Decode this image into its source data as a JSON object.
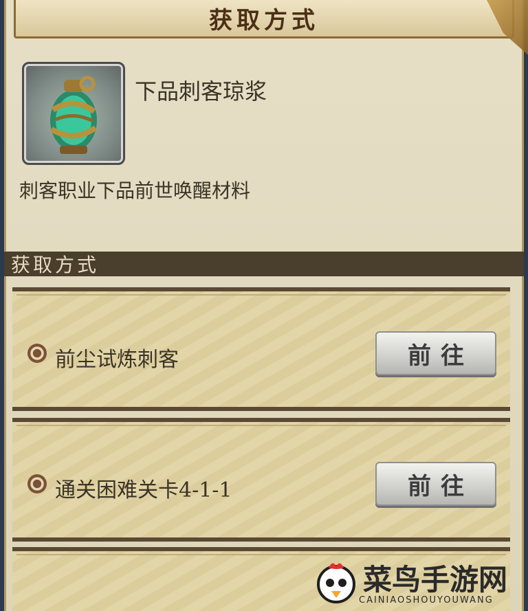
{
  "header": {
    "title": "获取方式"
  },
  "item": {
    "name": "下品刺客琼浆",
    "description": "刺客职业下品前世唤醒材料"
  },
  "section": {
    "title": "获取方式"
  },
  "sources": [
    {
      "label": "前尘试炼刺客",
      "button": "前往"
    },
    {
      "label": "通关困难关卡4-1-1",
      "button": "前往"
    }
  ],
  "watermark": {
    "main": "菜鸟手游网",
    "sub": "CAINIAOSHOUYOUWANG"
  },
  "colors": {
    "header_text": "#4a2f16",
    "section_bar": "#4a3e2c",
    "panel": "#e6dfc6"
  }
}
